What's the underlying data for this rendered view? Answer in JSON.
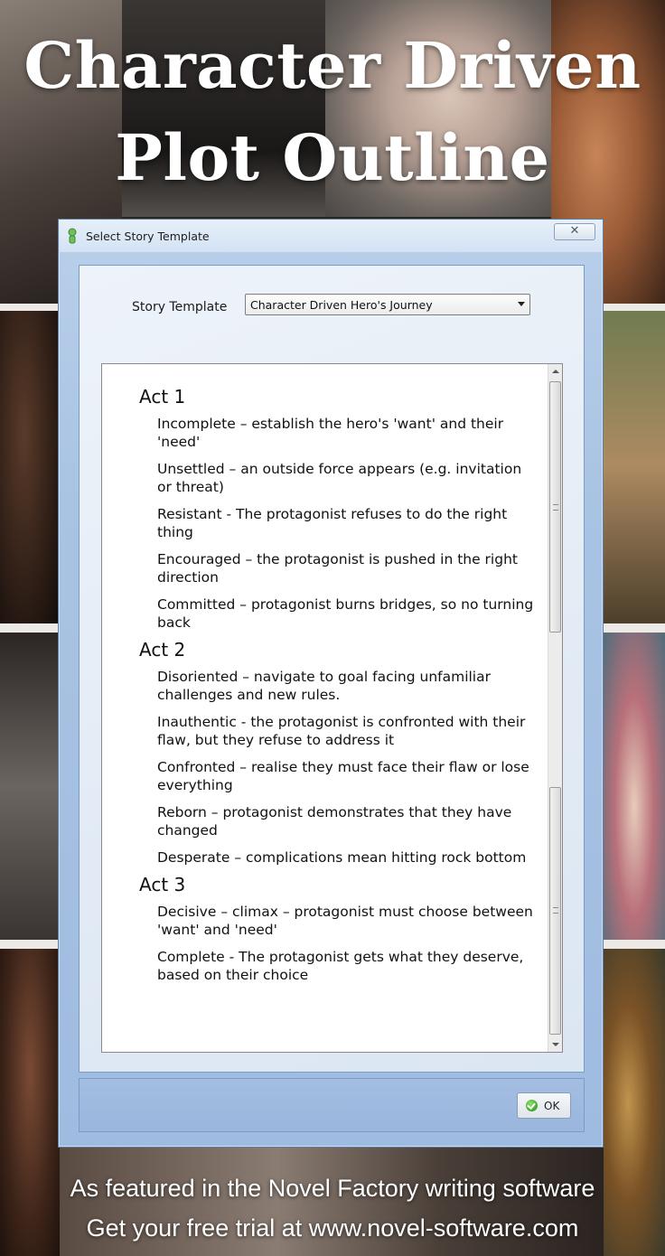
{
  "headline": {
    "line1": "Character Driven",
    "line2": "Plot Outline"
  },
  "window": {
    "title": "Select Story Template",
    "close_symbol": "✕"
  },
  "template": {
    "label": "Story Template",
    "selected": "Character Driven Hero's Journey"
  },
  "outline": {
    "act1": {
      "title": "Act 1",
      "beats": [
        "Incomplete – establish the hero's 'want' and their 'need'",
        "Unsettled – an outside force appears (e.g. invitation or threat)",
        "Resistant - The protagonist refuses to do the right thing",
        "Encouraged – the protagonist is pushed in the right direction",
        "Committed – protagonist burns bridges, so no turning back"
      ]
    },
    "act2": {
      "title": "Act 2",
      "beats": [
        "Disoriented – navigate to goal facing unfamiliar challenges and new rules.",
        "Inauthentic - the protagonist is confronted with their flaw, but they refuse to address it",
        "Confronted – realise they must face their flaw or lose everything",
        "Reborn – protagonist demonstrates that they have changed",
        "Desperate – complications mean hitting rock bottom"
      ]
    },
    "act3": {
      "title": "Act 3",
      "beats": [
        "Decisive – climax – protagonist must choose between 'want' and 'need'",
        "Complete - The protagonist gets what they deserve, based on their choice"
      ]
    }
  },
  "ok_button": {
    "label": "OK",
    "icon": "check-circle-icon"
  },
  "caption": {
    "line1": "As featured in the Novel Factory writing software",
    "line2": "Get your free trial at www.novel-software.com"
  }
}
